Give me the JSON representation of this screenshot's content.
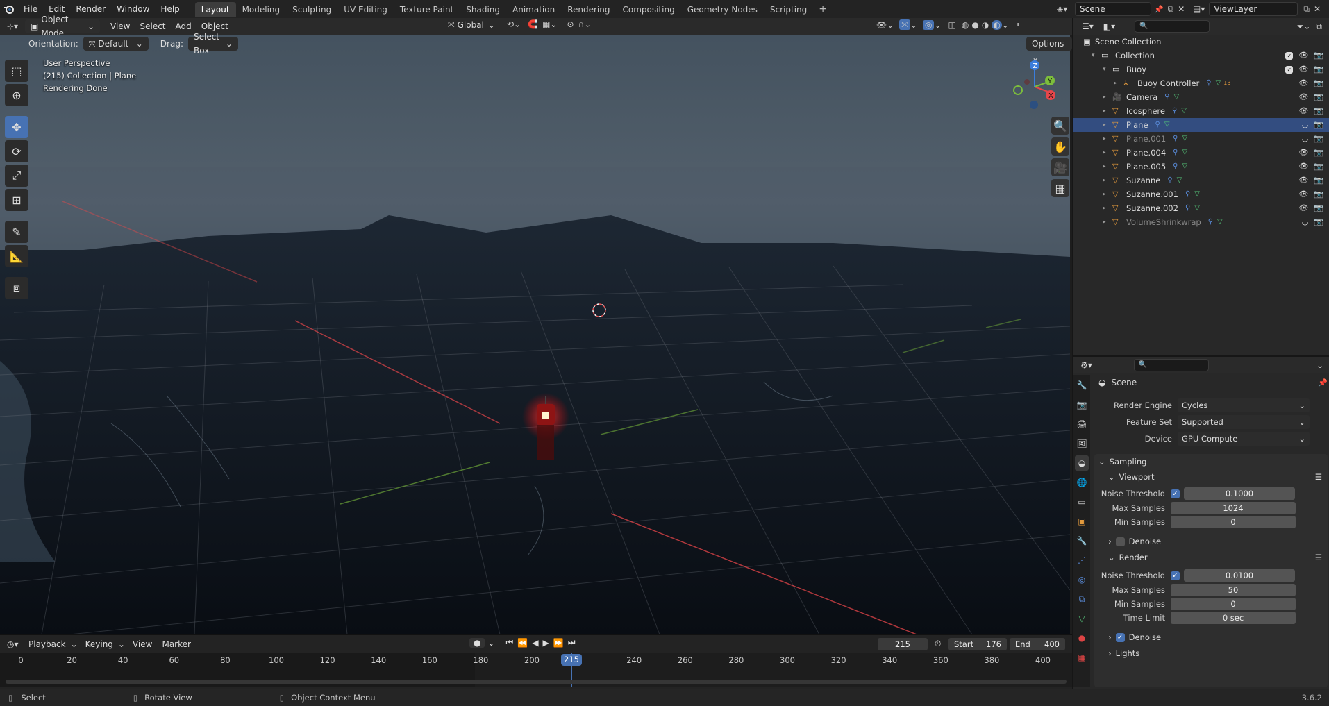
{
  "topbar": {
    "menus": [
      "File",
      "Edit",
      "Render",
      "Window",
      "Help"
    ],
    "workspaces": [
      "Layout",
      "Modeling",
      "Sculpting",
      "UV Editing",
      "Texture Paint",
      "Shading",
      "Animation",
      "Rendering",
      "Compositing",
      "Geometry Nodes",
      "Scripting"
    ],
    "active_workspace": "Layout",
    "add_tab": "+",
    "scene_name": "Scene",
    "view_layer": "ViewLayer"
  },
  "viewport_header": {
    "mode": "Object Mode",
    "menus": [
      "View",
      "Select",
      "Add",
      "Object"
    ],
    "transform": "Global",
    "orientation_label": "Orientation:",
    "orientation_value": "Default",
    "drag_label": "Drag:",
    "drag_value": "Select Box",
    "options": "Options"
  },
  "viewport": {
    "line1": "User Perspective",
    "line2": "(215) Collection | Plane",
    "line3": "Rendering Done",
    "gizmo_axes": [
      "Z",
      "Y",
      "X"
    ]
  },
  "timeline": {
    "menus": [
      "Playback",
      "Keying",
      "View",
      "Marker"
    ],
    "current_frame": "215",
    "start_label": "Start",
    "start": "176",
    "end_label": "End",
    "end": "400",
    "ticks": [
      "0",
      "20",
      "40",
      "60",
      "80",
      "100",
      "120",
      "140",
      "160",
      "180",
      "200",
      "215",
      "240",
      "260",
      "280",
      "300",
      "320",
      "340",
      "360",
      "380",
      "400"
    ]
  },
  "statusbar": {
    "select": "Select",
    "rotate": "Rotate View",
    "context": "Object Context Menu",
    "version": "3.6.2"
  },
  "outliner": {
    "root": "Scene Collection",
    "items": [
      {
        "label": "Collection",
        "indent": 1,
        "type": "collection"
      },
      {
        "label": "Buoy",
        "indent": 2,
        "type": "collection"
      },
      {
        "label": "Buoy Controller",
        "indent": 3,
        "type": "armature",
        "extra": "13"
      },
      {
        "label": "Camera",
        "indent": 2,
        "type": "camera"
      },
      {
        "label": "Icosphere",
        "indent": 2,
        "type": "mesh"
      },
      {
        "label": "Plane",
        "indent": 2,
        "type": "mesh",
        "selected": true
      },
      {
        "label": "Plane.001",
        "indent": 2,
        "type": "mesh",
        "dim": true
      },
      {
        "label": "Plane.004",
        "indent": 2,
        "type": "mesh"
      },
      {
        "label": "Plane.005",
        "indent": 2,
        "type": "mesh"
      },
      {
        "label": "Suzanne",
        "indent": 2,
        "type": "mesh"
      },
      {
        "label": "Suzanne.001",
        "indent": 2,
        "type": "mesh"
      },
      {
        "label": "Suzanne.002",
        "indent": 2,
        "type": "mesh"
      },
      {
        "label": "VolumeShrinkwrap",
        "indent": 2,
        "type": "mesh",
        "dim": true
      }
    ]
  },
  "properties": {
    "context": "Scene",
    "render_engine_label": "Render Engine",
    "render_engine": "Cycles",
    "feature_set_label": "Feature Set",
    "feature_set": "Supported",
    "device_label": "Device",
    "device": "GPU Compute",
    "sampling": "Sampling",
    "viewport": "Viewport",
    "vp_noise_label": "Noise Threshold",
    "vp_noise": "0.1000",
    "vp_max_label": "Max Samples",
    "vp_max": "1024",
    "vp_min_label": "Min Samples",
    "vp_min": "0",
    "vp_denoise": "Denoise",
    "render": "Render",
    "r_noise_label": "Noise Threshold",
    "r_noise": "0.0100",
    "r_max_label": "Max Samples",
    "r_max": "50",
    "r_min_label": "Min Samples",
    "r_min": "0",
    "r_time_label": "Time Limit",
    "r_time": "0 sec",
    "r_denoise": "Denoise",
    "lights": "Lights"
  },
  "colors": {
    "accent": "#4772b3",
    "selected_row": "#334d80",
    "axis_x": "#e8464a",
    "axis_y": "#7cbd3c",
    "axis_z": "#3b7ddb"
  }
}
